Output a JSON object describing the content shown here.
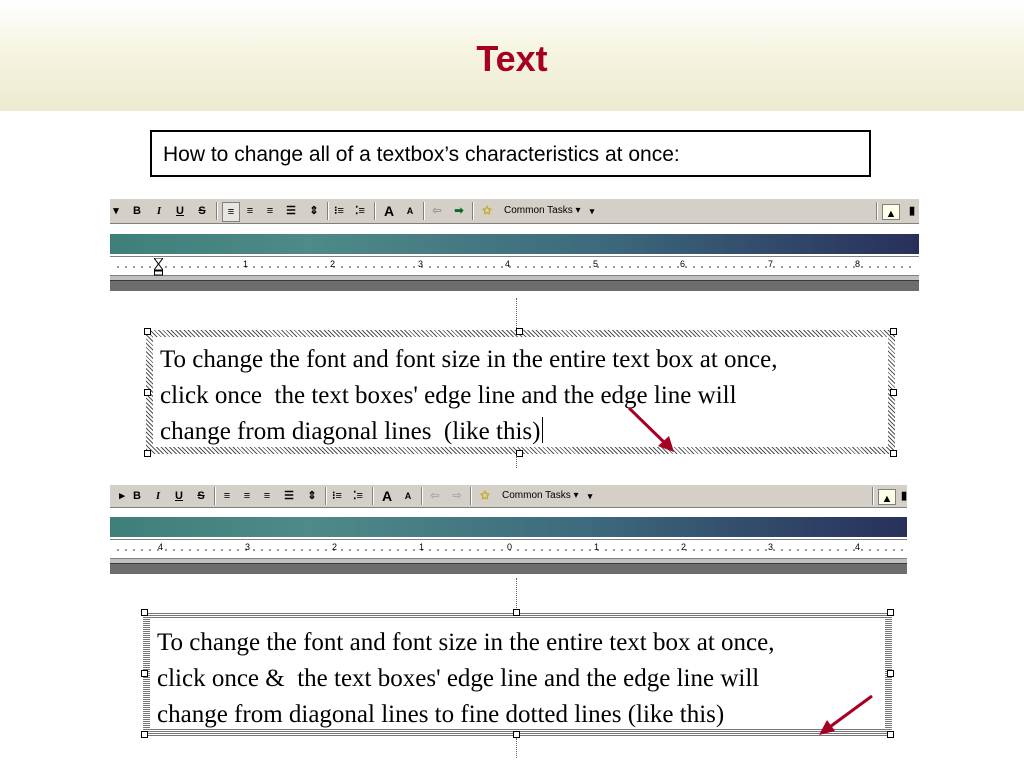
{
  "slide": {
    "title": "Text",
    "subtitle": "How to change all of a textbox’s characteristics at once:"
  },
  "toolbar_top": {
    "bold": "B",
    "italic": "I",
    "underline": "U",
    "shadow": "S",
    "grow_font": "A",
    "shrink_font": "A",
    "common_tasks": "Common Tasks ▾",
    "dropdown": "▾"
  },
  "ruler_top": {
    "labels": [
      "1",
      "2",
      "3",
      "4",
      "5",
      "6",
      "7",
      "8"
    ]
  },
  "ruler_bottom": {
    "labels": [
      "4",
      "3",
      "2",
      "1",
      "0",
      "1",
      "2",
      "3",
      "4"
    ]
  },
  "textbox_1": {
    "line1": "To change the font and font size in the entire text box at once,",
    "line2": "click once  the text boxes' edge line and the edge line will",
    "line3": "change from diagonal lines  (like this)"
  },
  "textbox_2": {
    "line1": "To change the font and font size in the entire text box at once,",
    "line2": "click once &  the text boxes' edge line and the edge line will",
    "line3": "change from diagonal lines to fine dotted lines (like this)"
  },
  "colors": {
    "title": "#a50021",
    "arrow": "#a50021"
  },
  "icons": [
    "align-left-icon",
    "align-center-icon",
    "align-right-icon",
    "distribute-icon",
    "line-spacing-icon",
    "numbering-icon",
    "bullets-icon",
    "increase-font-icon",
    "decrease-font-icon",
    "promote-icon",
    "demote-icon",
    "animation-icon",
    "insert-picture-icon"
  ]
}
